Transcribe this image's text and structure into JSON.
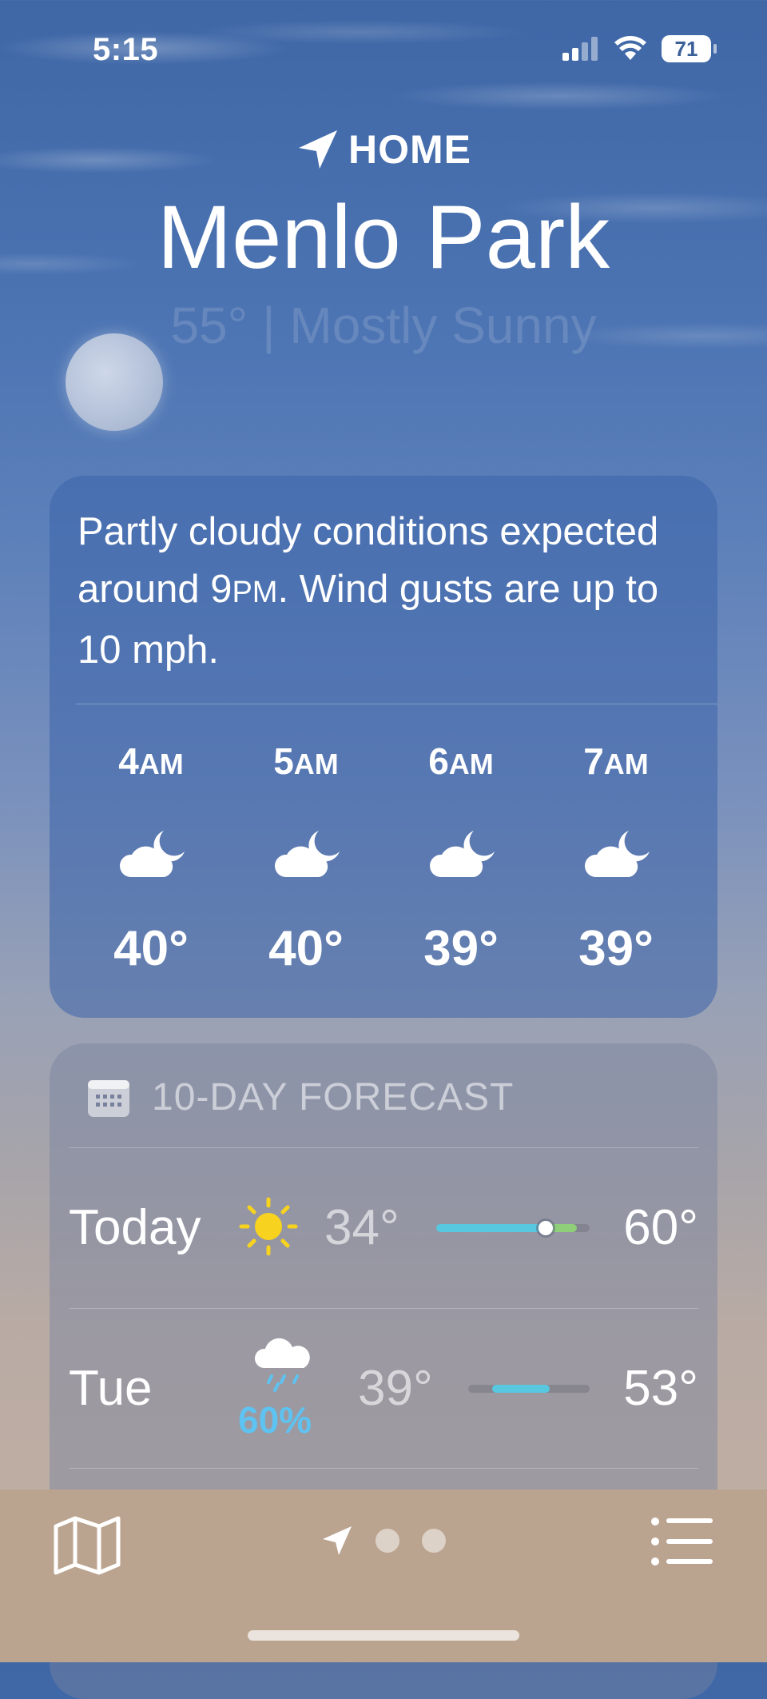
{
  "status_bar": {
    "time": "5:15",
    "battery": "71"
  },
  "header": {
    "location_label": "HOME",
    "city": "Menlo Park",
    "condition": "55° | Mostly Sunny"
  },
  "hourly": {
    "summary_1": "Partly cloudy conditions expected around 9",
    "summary_pm": "PM",
    "summary_2": ". Wind gusts are up to 10 mph.",
    "hours": [
      {
        "hour": "4",
        "suffix": "AM",
        "icon": "partly-cloudy-night-icon",
        "temp": "40°"
      },
      {
        "hour": "5",
        "suffix": "AM",
        "icon": "partly-cloudy-night-icon",
        "temp": "40°"
      },
      {
        "hour": "6",
        "suffix": "AM",
        "icon": "partly-cloudy-night-icon",
        "temp": "39°"
      },
      {
        "hour": "7",
        "suffix": "AM",
        "icon": "partly-cloudy-night-icon",
        "temp": "39°"
      }
    ]
  },
  "forecast": {
    "title": "10-DAY FORECAST",
    "days": [
      {
        "day": "Today",
        "icon": "sun-icon",
        "low": "34°",
        "high": "60°",
        "precip": ""
      },
      {
        "day": "Tue",
        "icon": "rain-cloud-icon",
        "low": "39°",
        "high": "53°",
        "precip": "60%"
      }
    ]
  },
  "colors": {
    "precip": "#5ec3f1",
    "bar_cool": "#58c8e0",
    "bar_warm": "#8fcf7a",
    "sun": "#f7d21e"
  }
}
